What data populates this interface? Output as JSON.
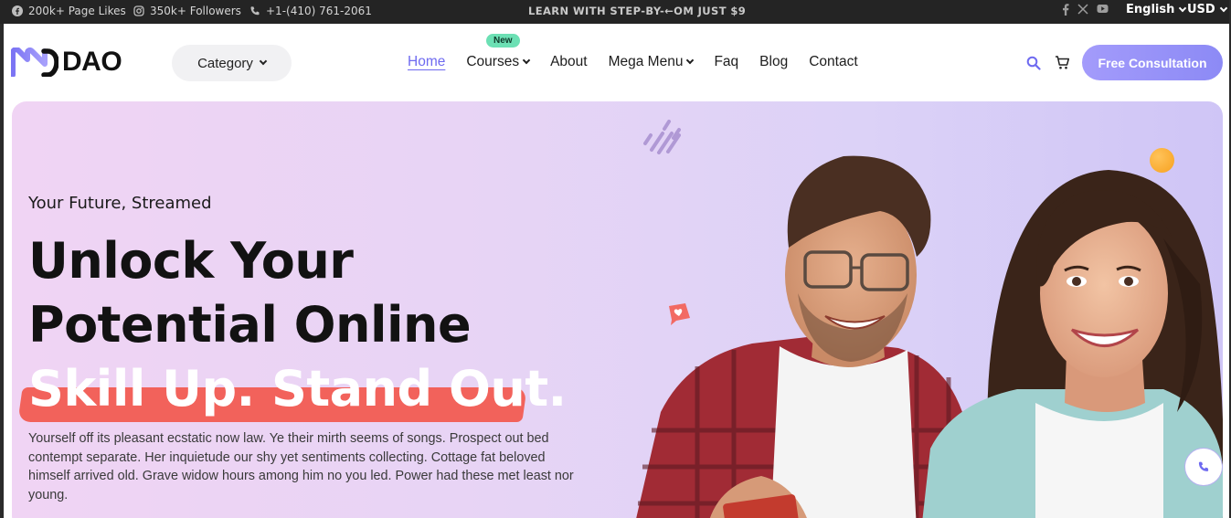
{
  "topbar": {
    "page_likes": "200k+ Page Likes",
    "followers": "350k+ Followers",
    "phone": "+1-(410) 761-2061",
    "promo": "LEARN WITH STEP-BY-←OM JUST $9",
    "language": "English",
    "currency": "USD"
  },
  "header": {
    "logo_text": "DAO",
    "category_label": "Category",
    "nav": [
      "Home",
      "Courses",
      "About",
      "Mega Menu",
      "Faq",
      "Blog",
      "Contact"
    ],
    "new_badge": "New",
    "cta_label": "Free Consultation"
  },
  "hero": {
    "eyebrow": "Your Future, Streamed",
    "headline_line1": "Unlock Your",
    "headline_line2": "Potential Online",
    "headline_line3": "Skill Up. Stand Out.",
    "description": "Yourself off its pleasant ecstatic now law. Ye their mirth seems of songs. Prospect out bed contempt separate. Her inquietude our shy yet sentiments collecting. Cottage fat beloved himself arrived old. Grave widow hours among him no you led. Power had these met least nor young."
  },
  "colors": {
    "accent": "#6e6af0",
    "cta_gradient_start": "#a39bfb",
    "highlight_brush": "#f2625b",
    "badge_new": "#6ce0b4",
    "topbar_bg": "#242424"
  },
  "icons": [
    "facebook-icon",
    "instagram-icon",
    "phone-icon",
    "x-icon",
    "youtube-icon",
    "search-icon",
    "cart-icon",
    "chevron-down-icon",
    "phone-call-icon"
  ]
}
